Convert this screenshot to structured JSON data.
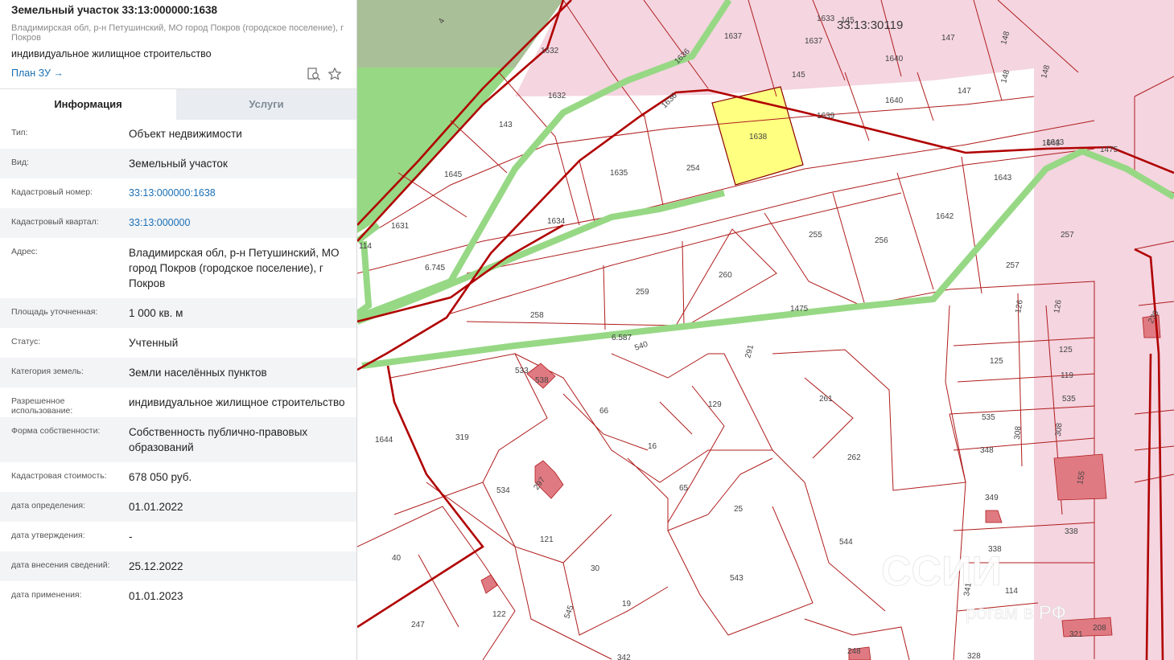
{
  "header": {
    "title": "Земельный участок 33:13:000000:1638",
    "address": "Владимирская обл, р-н Петушинский, МО город Покров (городское поселение), г Покров",
    "usage": "индивидуальное жилищное строительство",
    "plan_link": "План ЗУ →",
    "icons": [
      "search-doc-icon",
      "star-icon"
    ]
  },
  "tabs": [
    {
      "label": "Информация",
      "active": true
    },
    {
      "label": "Услуги",
      "active": false
    }
  ],
  "info": [
    {
      "key": "Тип:",
      "value": "Объект недвижимости"
    },
    {
      "key": "Вид:",
      "value": "Земельный участок"
    },
    {
      "key": "Кадастровый номер:",
      "value": "33:13:000000:1638"
    },
    {
      "key": "Кадастровый квартал:",
      "value": "33:13:000000"
    },
    {
      "key": "Адрес:",
      "value": "Владимирская обл, р-н Петушинский, МО город Покров (городское поселение), г Покров"
    },
    {
      "key": "Площадь уточненная:",
      "value": "1 000 кв. м"
    },
    {
      "key": "Статус:",
      "value": "Учтенный"
    },
    {
      "key": "Категория земель:",
      "value": "Земли населённых пунктов"
    },
    {
      "key": "Разрешенное использование:",
      "value": "индивидуальное жилищное строительство"
    },
    {
      "key": "Форма собственности:",
      "value": "Собственность публично-правовых образований"
    },
    {
      "key": "Кадастровая стоимость:",
      "value": "678 050 руб."
    },
    {
      "key": "дата определения:",
      "value": "01.01.2022"
    },
    {
      "key": "дата утверждения:",
      "value": "-"
    },
    {
      "key": "дата внесения сведений:",
      "value": "25.12.2022"
    },
    {
      "key": "дата применения:",
      "value": "01.01.2023"
    }
  ],
  "map": {
    "quarter_label": "33:13:30119",
    "watermark_line1": "ССИИ",
    "watermark_line2": "рогам в РФ",
    "road_label_1": "6.745",
    "road_label_2": "6.587",
    "road_label_3": "114",
    "parcels": [
      "1633",
      "145",
      "1637",
      "147",
      "148",
      "4",
      "1632",
      "1636",
      "1637",
      "145",
      "1640",
      "147",
      "148",
      "148",
      "1632",
      "1636",
      "1638",
      "1639",
      "1640",
      "143",
      "1635",
      "254",
      "1643",
      "1475",
      "1645",
      "1643",
      "1631",
      "1634",
      "255",
      "256",
      "1642",
      "257",
      "257",
      "260",
      "259",
      "258",
      "1475",
      "126",
      "126",
      "540",
      "125",
      "125",
      "291",
      "533",
      "538",
      "261",
      "119",
      "129",
      "66",
      "535",
      "535",
      "1644",
      "319",
      "16",
      "308",
      "348",
      "308",
      "262",
      "349",
      "155",
      "534",
      "297",
      "65",
      "25",
      "338",
      "121",
      "544",
      "40",
      "30",
      "338",
      "543",
      "341",
      "114",
      "19",
      "122",
      "247",
      "545",
      "321",
      "208",
      "248",
      "328",
      "342",
      "1643",
      "239"
    ],
    "colors": {
      "selected": "#ffff80",
      "pink": "#f4d5e0",
      "green": "#97d885",
      "olive": "#a9bf97",
      "red": "#b00000"
    }
  }
}
